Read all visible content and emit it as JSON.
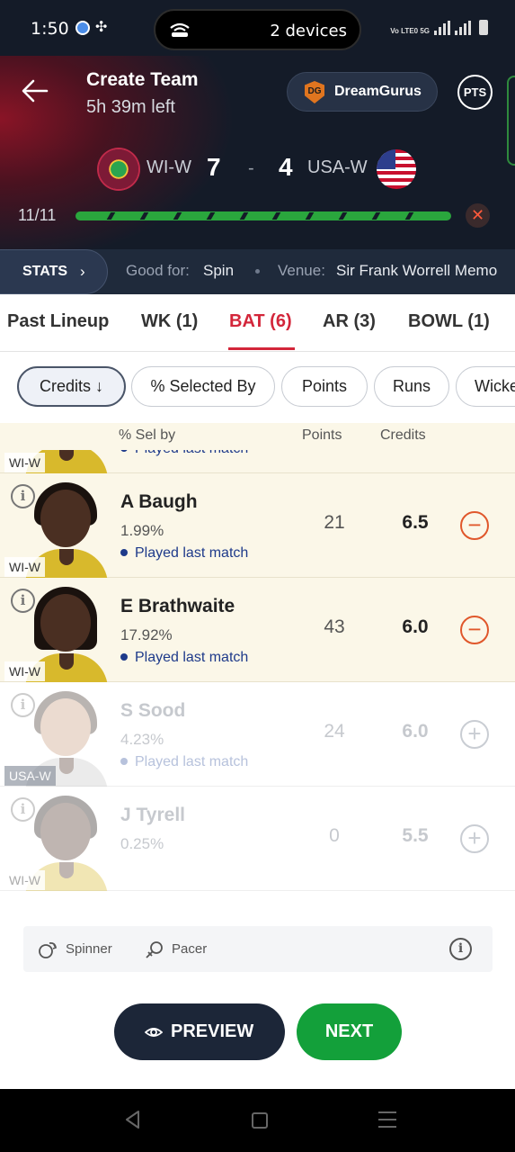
{
  "status_bar": {
    "time": "1:50",
    "hotspot": "2 devices",
    "network": "Vo LTE0 5G"
  },
  "header": {
    "title": "Create Team",
    "time_left": "5h 39m left",
    "dreamgurus_label": "DreamGurus",
    "dreamgurus_logo": "DG",
    "pts_label": "PTS",
    "match": {
      "team_left": "WI-W",
      "score_left": "7",
      "separator": "-",
      "score_right": "4",
      "team_right": "USA-W"
    },
    "players_count": "11/11",
    "progress_fraction": 1.0
  },
  "stats_bar": {
    "button_label": "STATS",
    "good_for_label": "Good for:",
    "good_for_value": "Spin",
    "venue_label": "Venue:",
    "venue_value": "Sir Frank Worrell Memo"
  },
  "tabs": [
    {
      "label": "Past Lineup",
      "active": false
    },
    {
      "label": "WK (1)",
      "active": false
    },
    {
      "label": "BAT (6)",
      "active": true
    },
    {
      "label": "AR (3)",
      "active": false
    },
    {
      "label": "BOWL (1)",
      "active": false
    }
  ],
  "sort_chips": [
    {
      "label": "Credits ↓",
      "active": true
    },
    {
      "label": "% Selected By",
      "active": false
    },
    {
      "label": "Points",
      "active": false
    },
    {
      "label": "Runs",
      "active": false
    },
    {
      "label": "Wicke",
      "active": false
    }
  ],
  "columns": {
    "sel_by": "% Sel by",
    "points": "Points",
    "credits": "Credits"
  },
  "partial_row": {
    "team": "WI-W",
    "played": "Played last match"
  },
  "players": [
    {
      "name": "A Baugh",
      "sel": "1.99%",
      "played": "Played last match",
      "points": "21",
      "credits": "6.5",
      "team": "WI-W",
      "selected": true
    },
    {
      "name": "E Brathwaite",
      "sel": "17.92%",
      "played": "Played last match",
      "points": "43",
      "credits": "6.0",
      "team": "WI-W",
      "selected": true
    },
    {
      "name": "S Sood",
      "sel": "4.23%",
      "played": "Played last match",
      "points": "24",
      "credits": "6.0",
      "team": "USA-W",
      "selected": false
    },
    {
      "name": "J Tyrell",
      "sel": "0.25%",
      "played": "",
      "points": "0",
      "credits": "5.5",
      "team": "WI-W",
      "selected": false
    }
  ],
  "icons": {
    "selected_action": "minus-circle-icon",
    "add_action": "plus-circle-icon",
    "info": "info-icon"
  },
  "legend": {
    "spinner": "Spinner",
    "pacer": "Pacer"
  },
  "actions": {
    "preview": "PREVIEW",
    "next": "NEXT"
  },
  "colors": {
    "accent_red": "#d3263a",
    "green": "#13a03a",
    "navy": "#1c2638",
    "selected_row": "#fbf7e8",
    "remove_orange": "#e0572b"
  }
}
